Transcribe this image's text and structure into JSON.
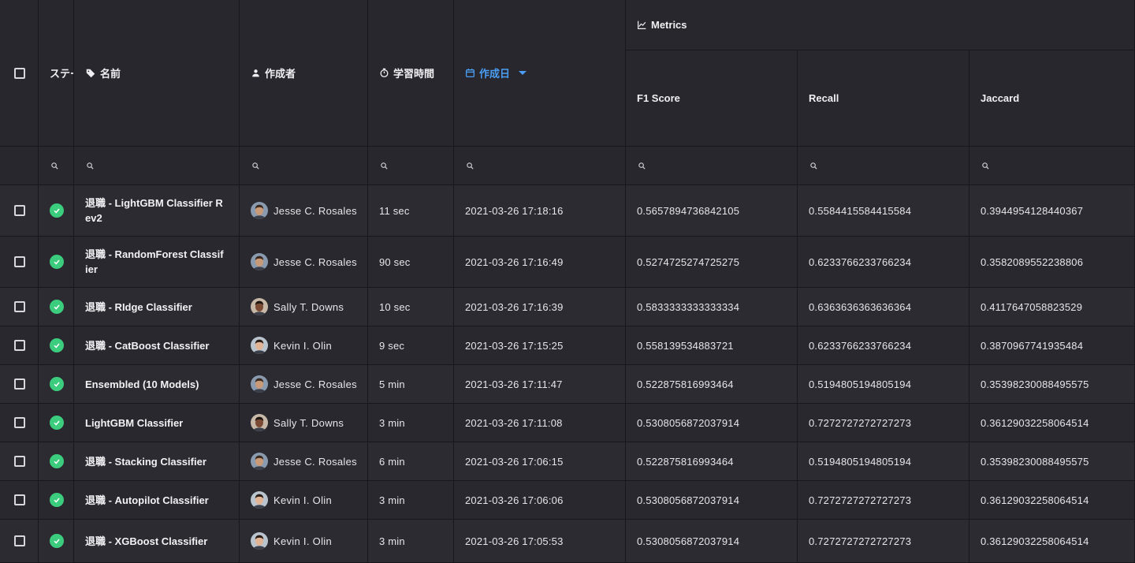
{
  "columns": {
    "status": "ステータス",
    "name": "名前",
    "creator": "作成者",
    "train_time": "学習時間",
    "created": "作成日",
    "metrics_group": "Metrics",
    "f1": "F1 Score",
    "recall": "Recall",
    "jaccard": "Jaccard"
  },
  "sort": {
    "column": "created",
    "direction": "desc"
  },
  "colors": {
    "accent": "#4a9ef5",
    "status_ok": "#3ccc7e"
  },
  "rows": [
    {
      "status": "check-circle-icon",
      "name": "退職 - LightGBM Classifier Rev2",
      "creator": "Jesse C. Rosales",
      "time": "11 sec",
      "created": "2021-03-26 17:18:16",
      "f1": "0.5657894736842105",
      "recall": "0.5584415584415584",
      "jaccard": "0.3944954128440367"
    },
    {
      "status": "check-circle-icon",
      "name": "退職 - RandomForest Classifier",
      "creator": "Jesse C. Rosales",
      "time": "90 sec",
      "created": "2021-03-26 17:16:49",
      "f1": "0.5274725274725275",
      "recall": "0.6233766233766234",
      "jaccard": "0.3582089552238806"
    },
    {
      "status": "check-circle-icon",
      "name": "退職 - RIdge Classifier",
      "creator": "Sally T. Downs",
      "time": "10 sec",
      "created": "2021-03-26 17:16:39",
      "f1": "0.5833333333333334",
      "recall": "0.6363636363636364",
      "jaccard": "0.4117647058823529"
    },
    {
      "status": "check-circle-icon",
      "name": "退職 - CatBoost Classifier",
      "creator": "Kevin I. Olin",
      "time": "9 sec",
      "created": "2021-03-26 17:15:25",
      "f1": "0.558139534883721",
      "recall": "0.6233766233766234",
      "jaccard": "0.3870967741935484"
    },
    {
      "status": "check-circle-icon",
      "name": "Ensembled (10 Models)",
      "creator": "Jesse C. Rosales",
      "time": "5 min",
      "created": "2021-03-26 17:11:47",
      "f1": "0.522875816993464",
      "recall": "0.5194805194805194",
      "jaccard": "0.35398230088495575"
    },
    {
      "status": "check-circle-icon",
      "name": "LightGBM Classifier",
      "creator": "Sally T. Downs",
      "time": "3 min",
      "created": "2021-03-26 17:11:08",
      "f1": "0.5308056872037914",
      "recall": "0.7272727272727273",
      "jaccard": "0.36129032258064514"
    },
    {
      "status": "check-circle-icon",
      "name": "退職 - Stacking Classifier",
      "creator": "Jesse C. Rosales",
      "time": "6 min",
      "created": "2021-03-26 17:06:15",
      "f1": "0.522875816993464",
      "recall": "0.5194805194805194",
      "jaccard": "0.35398230088495575"
    },
    {
      "status": "check-circle-icon",
      "name": "退職 - Autopilot Classifier",
      "creator": "Kevin I. Olin",
      "time": "3 min",
      "created": "2021-03-26 17:06:06",
      "f1": "0.5308056872037914",
      "recall": "0.7272727272727273",
      "jaccard": "0.36129032258064514"
    },
    {
      "status": "check-circle-icon",
      "name": "退職 - XGBoost Classifier",
      "creator": "Kevin I. Olin",
      "time": "3 min",
      "created": "2021-03-26 17:05:53",
      "f1": "0.5308056872037914",
      "recall": "0.7272727272727273",
      "jaccard": "0.36129032258064514"
    }
  ]
}
